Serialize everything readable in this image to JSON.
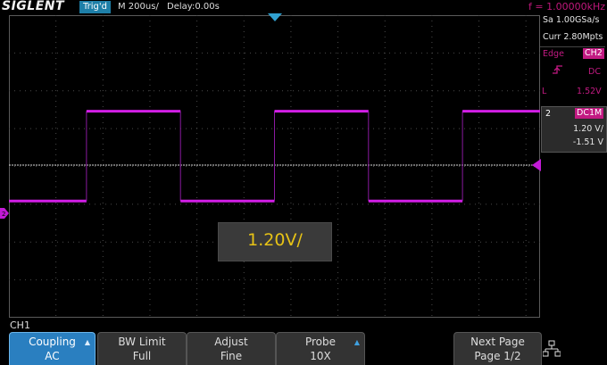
{
  "top": {
    "brand": "SIGLENT",
    "trig_status": "Trig'd",
    "timebase": "M 200us/",
    "delay": "Delay:0.00s",
    "frequency": "f = 1.00000kHz"
  },
  "acquisition": {
    "sample_rate": "Sa 1.00GSa/s",
    "memory_depth": "Curr 2.80Mpts"
  },
  "trigger": {
    "type": "Edge",
    "source": "CH2",
    "coupling": "DC",
    "level_label": "L",
    "level": "1.52V"
  },
  "channel_info": {
    "number": "2",
    "coupling": "DC1M",
    "scale": "1.20 V/",
    "offset": "-1.51 V"
  },
  "popup": {
    "value": "1.20V/"
  },
  "menu": {
    "channel": "CH1",
    "buttons": [
      {
        "line1": "Coupling",
        "line2": "AC"
      },
      {
        "line1": "BW Limit",
        "line2": "Full"
      },
      {
        "line1": "Adjust",
        "line2": "Fine"
      },
      {
        "line1": "Probe",
        "line2": "10X"
      },
      {
        "line1": "",
        "line2": ""
      },
      {
        "line1": "Next Page",
        "line2": "Page 1/2"
      }
    ]
  },
  "icons": {
    "trigger_position_marker": "down-triangle-icon",
    "trigger_level_marker": "left-triangle-icon",
    "channel_ground_marker": "channel-marker-icon",
    "rising_edge": "rising-edge-icon",
    "network": "network-icon",
    "menu_arrow": "up-arrow-icon"
  },
  "colors": {
    "channel2": "#c21a82",
    "trace": "#d21ee6",
    "accent_blue": "#1e7fa8",
    "menu_selected": "#2a7fc0",
    "popup_text": "#e7c316",
    "trigger_marker": "#30a0d0"
  },
  "waveform": {
    "type": "square",
    "high_level_div": 1.5,
    "low_level_div": -1,
    "trigger_level_div": 0,
    "transitions_div": [
      1.65,
      3.65,
      5.65,
      7.65,
      9.65,
      11.65
    ],
    "start_level": "low"
  }
}
